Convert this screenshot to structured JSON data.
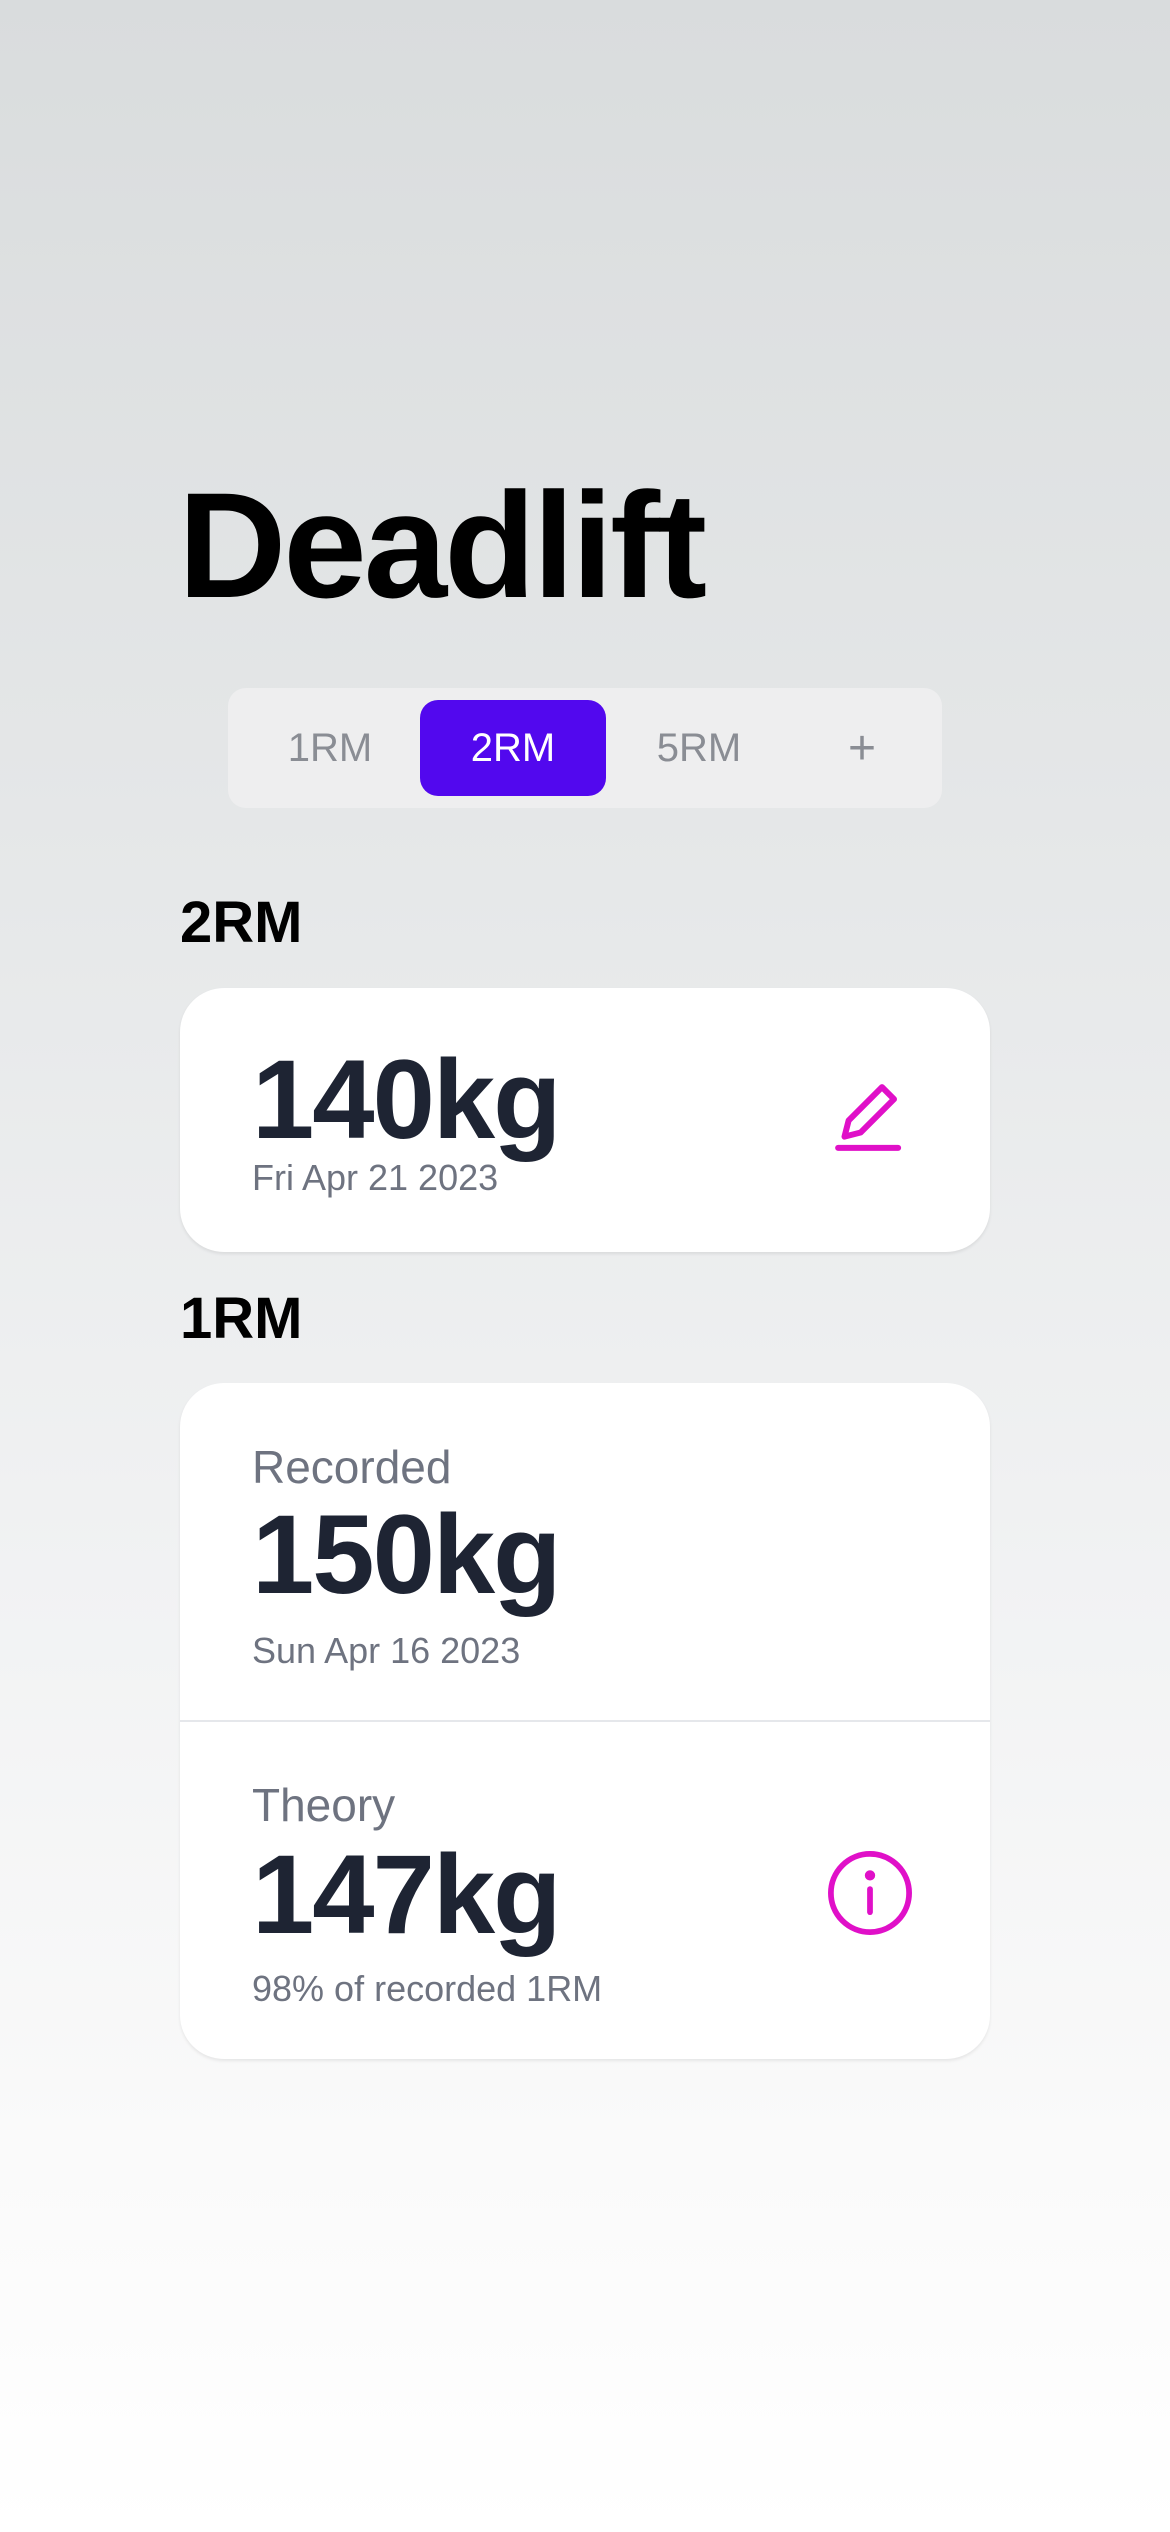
{
  "page": {
    "title": "Deadlift"
  },
  "tabs": {
    "items": [
      {
        "label": "1RM",
        "selected": false
      },
      {
        "label": "2RM",
        "selected": true
      },
      {
        "label": "5RM",
        "selected": false
      }
    ],
    "add_label": "+"
  },
  "sections": {
    "two_rm": {
      "heading": "2RM",
      "value": "140kg",
      "date": "Fri Apr 21 2023",
      "action_icon": "pencil-icon"
    },
    "one_rm": {
      "heading": "1RM",
      "recorded": {
        "label": "Recorded",
        "value": "150kg",
        "date": "Sun Apr 16 2023"
      },
      "theory": {
        "label": "Theory",
        "value": "147kg",
        "note": "98% of recorded 1RM",
        "action_icon": "info-icon"
      }
    }
  },
  "colors": {
    "accent": "#5208ee",
    "icon": "#e010c8",
    "value_text": "#1e2433",
    "muted_text": "#6e7380"
  }
}
